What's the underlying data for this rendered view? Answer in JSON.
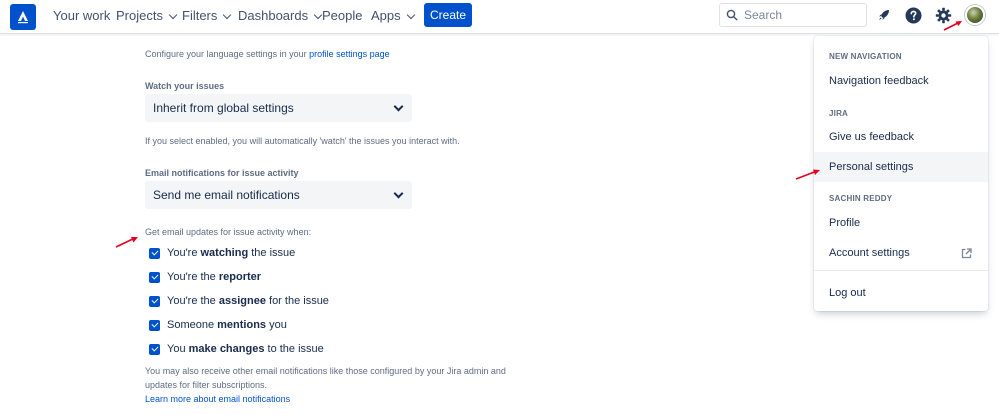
{
  "topnav": {
    "items": [
      {
        "label": "Your work",
        "dropdown": false
      },
      {
        "label": "Projects",
        "dropdown": true
      },
      {
        "label": "Filters",
        "dropdown": true
      },
      {
        "label": "Dashboards",
        "dropdown": true
      },
      {
        "label": "People",
        "dropdown": false
      },
      {
        "label": "Apps",
        "dropdown": true
      }
    ],
    "create_label": "Create",
    "search_placeholder": "Search",
    "icons": [
      "atlassian-logo-icon",
      "search-icon",
      "rocket-icon",
      "help-icon",
      "gear-icon",
      "avatar"
    ],
    "accent_color": "#0052cc"
  },
  "main": {
    "language_hint_prefix": "Configure your language settings in your ",
    "language_hint_link": "profile settings page",
    "watch_label": "Watch your issues",
    "watch_value": "Inherit from global settings",
    "watch_hint": "If you select enabled, you will automatically 'watch' the issues you interact with.",
    "email_label": "Email notifications for issue activity",
    "email_value": "Send me email notifications",
    "updates_hint": "Get email updates for issue activity when:",
    "checkboxes": [
      {
        "pre": "You're ",
        "bold": "watching",
        "post": " the issue",
        "checked": true
      },
      {
        "pre": "You're the ",
        "bold": "reporter",
        "post": "",
        "checked": true
      },
      {
        "pre": "You're the ",
        "bold": "assignee",
        "post": " for the issue",
        "checked": true
      },
      {
        "pre": "Someone ",
        "bold": "mentions",
        "post": " you",
        "checked": true
      },
      {
        "pre": "You ",
        "bold": "make changes",
        "post": " to the issue",
        "checked": true
      }
    ],
    "footer_line1": "You may also receive other email notifications like those configured by your Jira admin and",
    "footer_line2": "updates for filter subscriptions.",
    "footer_link": "Learn more about email notifications"
  },
  "menu": {
    "section1_heading": "NEW NAVIGATION",
    "navigation_feedback": "Navigation feedback",
    "section2_heading": "JIRA",
    "give_feedback": "Give us feedback",
    "personal_settings": "Personal settings",
    "section3_heading": "SACHIN REDDY",
    "profile": "Profile",
    "account_settings": "Account settings",
    "log_out": "Log out",
    "active_item": "Personal settings"
  },
  "annotation_color": "#e5001f"
}
